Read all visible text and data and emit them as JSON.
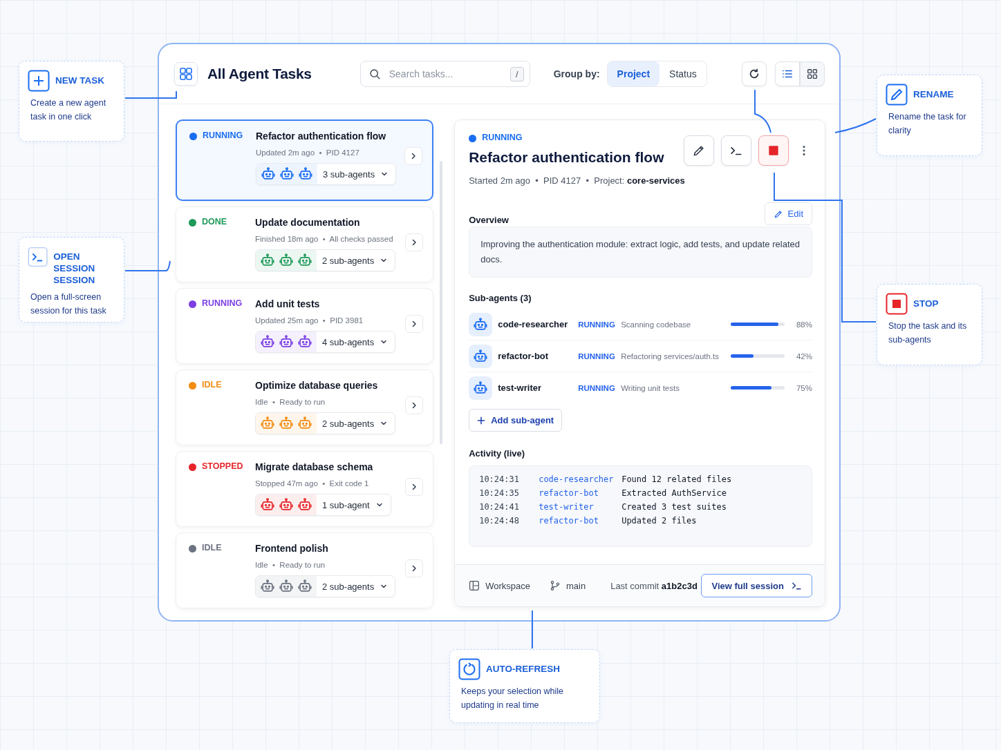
{
  "header": {
    "title": "All Agent Tasks",
    "search": {
      "placeholder": "Search tasks...",
      "shortcut": "/"
    },
    "group_by": {
      "label": "Group by:",
      "options": [
        {
          "label": "Project",
          "selected": true
        },
        {
          "label": "Status",
          "selected": false
        }
      ]
    }
  },
  "tasks": [
    {
      "status": "RUNNING",
      "color": "#1a6df0",
      "title": "Refactor authentication flow",
      "meta": "Updated 2m ago  •  PID 4127",
      "subagents": "3 sub-agents",
      "selected": true
    },
    {
      "status": "DONE",
      "color": "#1f9a5a",
      "title": "Update documentation",
      "meta": "Finished 18m ago  •  All checks passed",
      "subagents": "2 sub-agents",
      "selected": false
    },
    {
      "status": "RUNNING",
      "color": "#7b3fe4",
      "title": "Add unit tests",
      "meta": "Updated 25m ago  •  PID 3981",
      "subagents": "4 sub-agents",
      "selected": false
    },
    {
      "status": "IDLE",
      "color": "#f28c13",
      "title": "Optimize database queries",
      "meta": "Idle  •  Ready to run",
      "subagents": "2 sub-agents",
      "selected": false
    },
    {
      "status": "STOPPED",
      "color": "#e5252a",
      "title": "Migrate database schema",
      "meta": "Stopped 47m ago  •  Exit code 1",
      "subagents": "1 sub-agent",
      "selected": false
    },
    {
      "status": "IDLE",
      "color": "#6b7280",
      "title": "Frontend polish",
      "meta": "Idle  •  Ready to run",
      "subagents": "2 sub-agents",
      "selected": false
    }
  ],
  "detail": {
    "status": "RUNNING",
    "title": "Refactor authentication flow",
    "meta": "Started 2m ago  •  PID 4127  •  Project: **core-services**",
    "overview": {
      "heading": "Overview",
      "edit": "Edit",
      "text": "Improving the authentication module: extract logic, add tests, and update related docs."
    },
    "subagents": {
      "heading": "Sub-agents (3)",
      "items": [
        {
          "name": "code-researcher",
          "status": "RUNNING",
          "note": "Scanning codebase",
          "level": 0.88,
          "reading": "88%"
        },
        {
          "name": "refactor-bot",
          "status": "RUNNING",
          "note": "Refactoring services/auth.ts",
          "level": 0.42,
          "reading": "42%"
        },
        {
          "name": "test-writer",
          "status": "RUNNING",
          "note": "Writing unit tests",
          "level": 0.75,
          "reading": "75%"
        }
      ],
      "add": "Add sub-agent"
    },
    "activity": {
      "heading": "Activity (live)",
      "rows": [
        {
          "time": "10:24:31",
          "agent": "code-researcher",
          "message": "Found 12 related files"
        },
        {
          "time": "10:24:35",
          "agent": "refactor-bot",
          "message": "Extracted AuthService"
        },
        {
          "time": "10:24:41",
          "agent": "test-writer",
          "message": "Created 3 test suites"
        },
        {
          "time": "10:24:48",
          "agent": "refactor-bot",
          "message": "Updated 2 files"
        }
      ]
    },
    "footer": {
      "workspace": "Workspace",
      "branch": "main",
      "commit": "Last commit **a1b2c3d**",
      "view": "View full session"
    }
  },
  "callouts": [
    {
      "kind": "new",
      "title": "NEW TASK",
      "text": "Create a new agent task in one click"
    },
    {
      "kind": "session",
      "title": "OPEN SESSION SESSION",
      "text": "Open a full-screen session for this task"
    },
    {
      "kind": "rename",
      "title": "RENAME",
      "text": "Rename the task for clarity"
    },
    {
      "kind": "stop",
      "title": "STOP",
      "text": "Stop the task and its sub-agents"
    },
    {
      "kind": "refresh",
      "title": "AUTO-REFRESH",
      "text": "Keeps your selection while updating in real time"
    }
  ]
}
